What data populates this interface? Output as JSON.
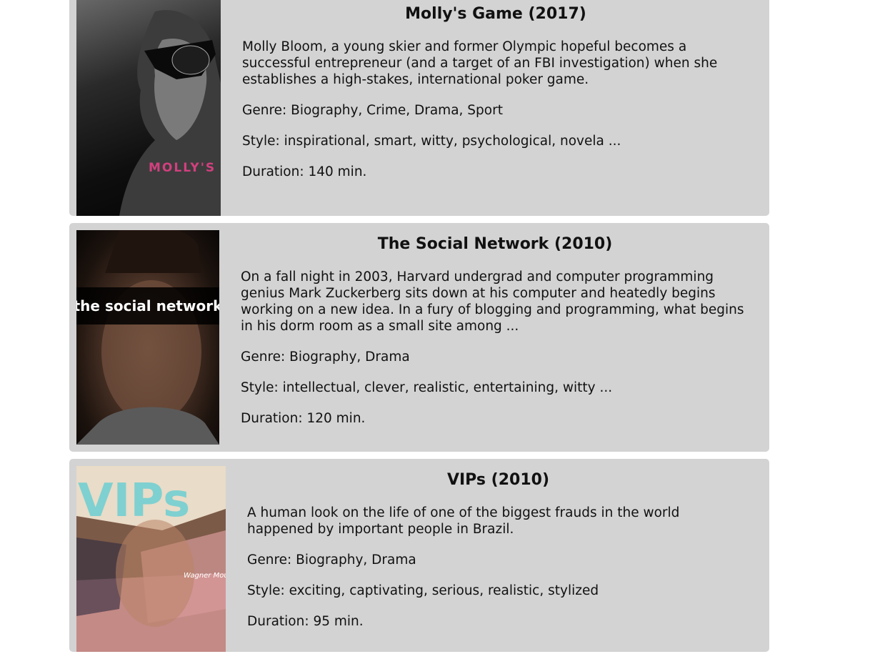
{
  "movies": [
    {
      "title": "Molly's Game (2017)",
      "description": "Molly Bloom, a young skier and former Olympic hopeful becomes a successful entrepreneur (and a target of an FBI investigation) when she establishes a high-stakes, international poker game.",
      "genre": "Genre: Biography, Crime, Drama, Sport",
      "style": "Style: inspirational, smart, witty, psychological, novela ...",
      "duration": "Duration: 140 min.",
      "poster_text": "MOLLY'S GAME"
    },
    {
      "title": "The Social Network (2010)",
      "description": "On a fall night in 2003, Harvard undergrad and computer programming genius Mark Zuckerberg sits down at his computer and heatedly begins working on a new idea. In a fury of blogging and programming, what begins in his dorm room as a small site among ...",
      "genre": "Genre: Biography, Drama",
      "style": "Style: intellectual, clever, realistic, entertaining, witty ...",
      "duration": "Duration: 120 min.",
      "poster_text": "the social network"
    },
    {
      "title": "VIPs (2010)",
      "description": "A human look on the life of one of the biggest frauds in the world happened by important people in Brazil.",
      "genre": "Genre: Biography, Drama",
      "style": "Style: exciting, captivating, serious, realistic, stylized",
      "duration": "Duration: 95 min.",
      "poster_text": "VIPs",
      "poster_credit": "Wagner Moura"
    }
  ],
  "colors": {
    "card_bg": "#d3d3d3",
    "molly_poster_title": "#d1407e"
  }
}
